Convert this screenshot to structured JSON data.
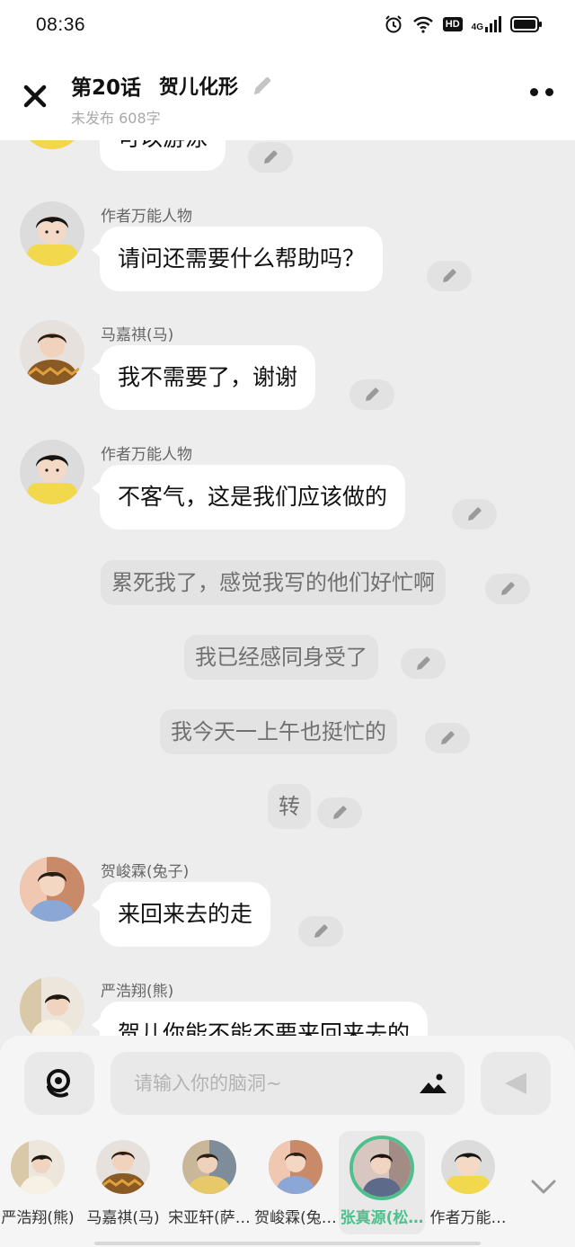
{
  "status_bar": {
    "time": "08:36",
    "hd": "HD",
    "network": "4G"
  },
  "header": {
    "chapter_no": "第20话",
    "chapter_title": "贺儿化形",
    "status": "未发布 608字"
  },
  "messages": [
    {
      "type": "dialog",
      "sender": "",
      "text": "可以游泳"
    },
    {
      "type": "dialog",
      "sender": "作者万能人物",
      "text": "请问还需要什么帮助吗？"
    },
    {
      "type": "dialog",
      "sender": "马嘉祺(马)",
      "text": "我不需要了，谢谢"
    },
    {
      "type": "dialog",
      "sender": "作者万能人物",
      "text": "不客气，这是我们应该做的"
    },
    {
      "type": "narration",
      "text": "累死我了，感觉我写的他们好忙啊"
    },
    {
      "type": "narration",
      "text": "我已经感同身受了"
    },
    {
      "type": "narration",
      "text": "我今天一上午也挺忙的"
    },
    {
      "type": "narration",
      "text": "转"
    },
    {
      "type": "dialog",
      "sender": "贺峻霖(兔子)",
      "text": "来回来去的走"
    },
    {
      "type": "dialog",
      "sender": "严浩翔(熊)",
      "text": "贺儿你能不能不要来回来去的"
    }
  ],
  "composer": {
    "placeholder": "请输入你的脑洞~"
  },
  "cast": [
    {
      "name": "严浩翔(熊)",
      "active": false
    },
    {
      "name": "马嘉祺(马)",
      "active": false
    },
    {
      "name": "宋亚轩(萨…",
      "active": false
    },
    {
      "name": "贺峻霖(兔…",
      "active": false
    },
    {
      "name": "张真源(松…",
      "active": true
    },
    {
      "name": "作者万能…",
      "active": false
    }
  ],
  "colors": {
    "accent": "#4fc08d",
    "bubble": "#ffffff",
    "background": "#ededed",
    "narration_bg": "#e3e3e3"
  }
}
